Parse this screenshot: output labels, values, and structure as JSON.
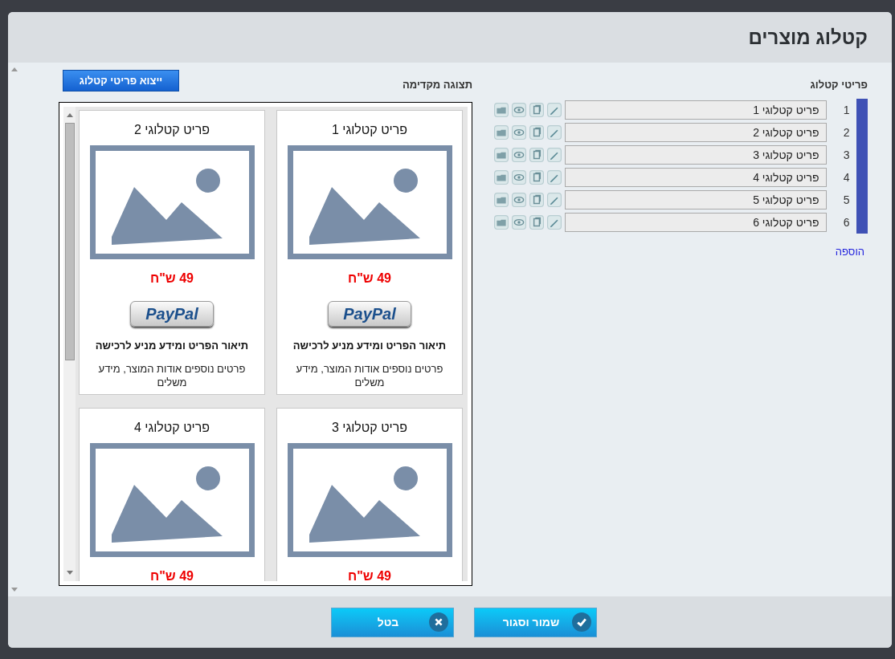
{
  "dialog": {
    "title": "קטלוג מוצרים"
  },
  "items_panel": {
    "heading": "פריטי קטלוג",
    "add_link": "הוספה",
    "rows": [
      {
        "number": "1",
        "value": "פריט קטלוגי 1"
      },
      {
        "number": "2",
        "value": "פריט קטלוגי 2"
      },
      {
        "number": "3",
        "value": "פריט קטלוגי 3"
      },
      {
        "number": "4",
        "value": "פריט קטלוגי 4"
      },
      {
        "number": "5",
        "value": "פריט קטלוגי 5"
      },
      {
        "number": "6",
        "value": "פריט קטלוגי 6"
      }
    ]
  },
  "preview_panel": {
    "heading": "תצוגה מקדימה",
    "export_button": "ייצוא פריטי קטלוג",
    "cards": [
      {
        "title": "פריט קטלוגי 1",
        "price": "49 ש\"ח",
        "payment_button": "PayPal",
        "description": "תיאור הפריט ומידע מניע לרכישה",
        "details": "פרטים נוספים אודות המוצר, מידע משלים"
      },
      {
        "title": "פריט קטלוגי 2",
        "price": "49 ש\"ח",
        "payment_button": "PayPal",
        "description": "תיאור הפריט ומידע מניע לרכישה",
        "details": "פרטים נוספים אודות המוצר, מידע משלים"
      },
      {
        "title": "פריט קטלוגי 3",
        "price": "49 ש\"ח"
      },
      {
        "title": "פריט קטלוגי 4",
        "price": "49 ש\"ח"
      }
    ]
  },
  "footer": {
    "buttons": [
      {
        "kind": "save",
        "label": "שמור וסגור"
      },
      {
        "kind": "cancel",
        "label": "בטל"
      }
    ]
  }
}
